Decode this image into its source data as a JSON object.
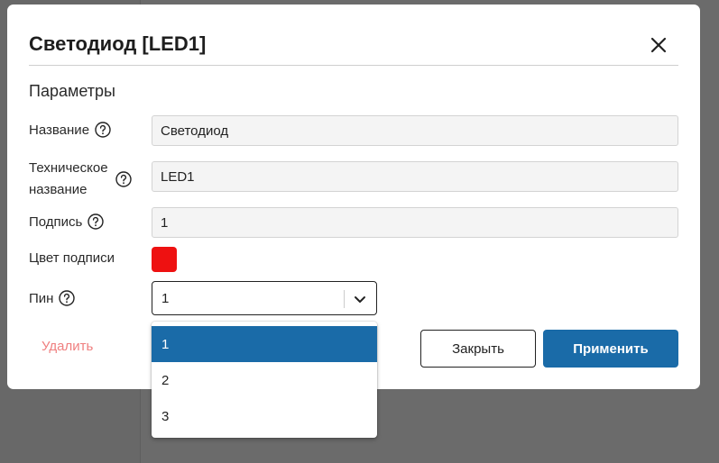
{
  "dialog": {
    "title": "Светодиод [LED1]",
    "section_title": "Параметры"
  },
  "fields": {
    "name": {
      "label": "Название",
      "value": "Светодиод"
    },
    "tech_name": {
      "label_line1": "Техническое",
      "label_line2": "название",
      "value": "LED1"
    },
    "caption": {
      "label": "Подпись",
      "value": "1"
    },
    "caption_color": {
      "label": "Цвет подписи",
      "color": "#ee1111"
    },
    "pin": {
      "label": "Пин",
      "value": "1"
    }
  },
  "dropdown": {
    "options": [
      "1",
      "2",
      "3"
    ],
    "selected": "1"
  },
  "buttons": {
    "delete": "Удалить",
    "close": "Закрыть",
    "apply": "Применить"
  },
  "colors": {
    "accent": "#1a6ba8",
    "danger_text": "#ef7f7f",
    "overlay": "#6b6b6b"
  },
  "icons": {
    "close": "close-icon",
    "help": "help-icon",
    "chevron": "chevron-down-icon"
  }
}
